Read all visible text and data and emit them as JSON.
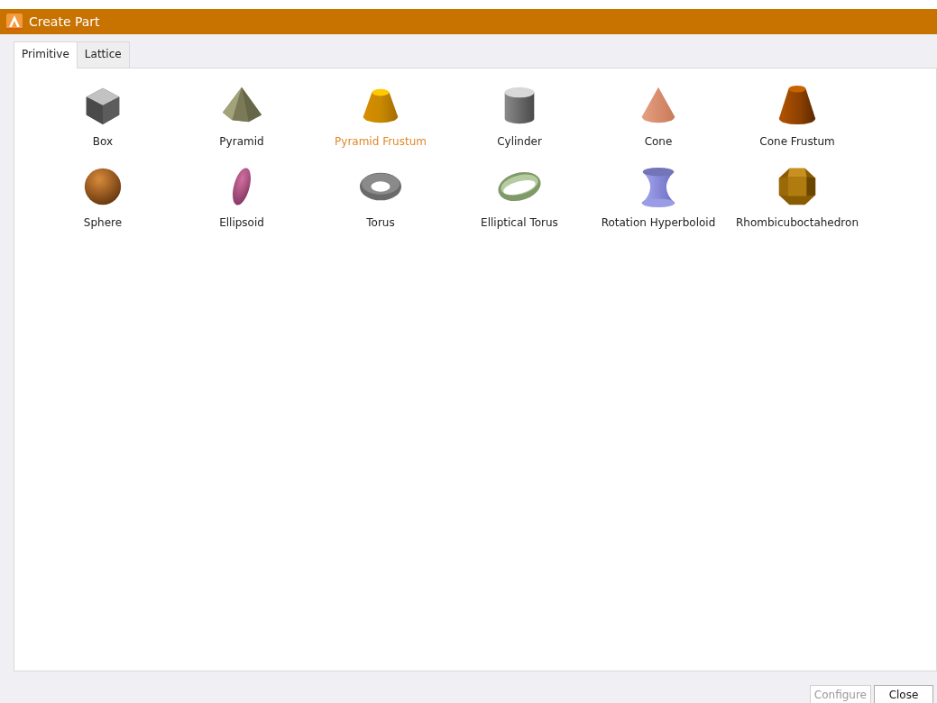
{
  "window": {
    "title": "Create Part"
  },
  "tabs": [
    {
      "label": "Primitive",
      "selected": true
    },
    {
      "label": "Lattice",
      "selected": false
    }
  ],
  "shapes": [
    {
      "label": "Box",
      "selected": false
    },
    {
      "label": "Pyramid",
      "selected": false
    },
    {
      "label": "Pyramid Frustum",
      "selected": true
    },
    {
      "label": "Cylinder",
      "selected": false
    },
    {
      "label": "Cone",
      "selected": false
    },
    {
      "label": "Cone Frustum",
      "selected": false
    },
    {
      "label": "Sphere",
      "selected": false
    },
    {
      "label": "Ellipsoid",
      "selected": false
    },
    {
      "label": "Torus",
      "selected": false
    },
    {
      "label": "Elliptical Torus",
      "selected": false
    },
    {
      "label": "Rotation Hyperboloid",
      "selected": false
    },
    {
      "label": "Rhombicuboctahedron",
      "selected": false
    }
  ],
  "buttons": [
    {
      "label": "Configure",
      "disabled": true
    },
    {
      "label": "Close",
      "disabled": false
    }
  ]
}
